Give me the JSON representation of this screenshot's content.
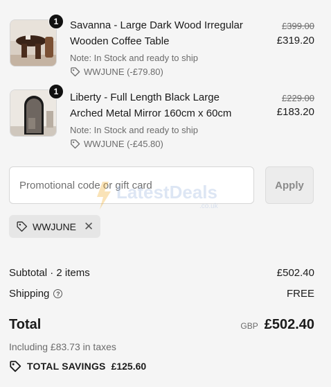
{
  "items": [
    {
      "quantity": "1",
      "title": "Savanna - Large Dark Wood Irregular Wooden Coffee Table",
      "note": "Note: In Stock and ready to ship",
      "discount": "WWJUNE (-£79.80)",
      "price_original": "£399.00",
      "price_final": "£319.20",
      "thumb_icon": "coffee-table-image"
    },
    {
      "quantity": "1",
      "title": "Liberty - Full Length Black Large Arched Metal Mirror 160cm x 60cm",
      "note": "Note: In Stock and ready to ship",
      "discount": "WWJUNE (-£45.80)",
      "price_original": "£229.00",
      "price_final": "£183.20",
      "thumb_icon": "arched-mirror-image"
    }
  ],
  "promo": {
    "placeholder": "Promotional code or gift card",
    "value": "",
    "apply_label": "Apply"
  },
  "applied_code": {
    "code": "WWJUNE",
    "remove_icon": "close-icon"
  },
  "watermark": {
    "line1": "LatestDeals",
    "line2": ".co.uk"
  },
  "summary": {
    "subtotal_label": "Subtotal · 2 items",
    "subtotal_value": "£502.40",
    "shipping_label": "Shipping",
    "shipping_value": "FREE",
    "total_label": "Total",
    "currency": "GBP",
    "total_value": "£502.40",
    "taxes_note": "Including £83.73 in taxes",
    "savings_label": "TOTAL SAVINGS",
    "savings_value": "£125.60"
  },
  "colors": {
    "background": "#f5f5f5",
    "text": "#1a1a1a",
    "muted": "#6b6b6b",
    "badge": "#111111"
  }
}
